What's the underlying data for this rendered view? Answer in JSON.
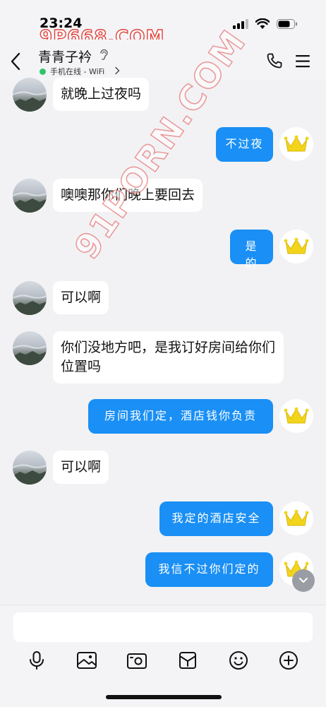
{
  "status_bar": {
    "time": "23:24",
    "watermark": "9P668.COM"
  },
  "header": {
    "contact_name": "青青子衿",
    "online_status": "手机在线 - WiFi"
  },
  "watermark_diag": "91PORN.COM",
  "messages": [
    {
      "side": "left",
      "text": "就晚上过夜吗"
    },
    {
      "side": "right",
      "text": "不过夜"
    },
    {
      "side": "left",
      "text": "噢噢那你们晚上要回去"
    },
    {
      "side": "right",
      "text": "是的"
    },
    {
      "side": "left",
      "text": "可以啊"
    },
    {
      "side": "left",
      "text": "你们没地方吧，是我订好房间给你们位置吗"
    },
    {
      "side": "right",
      "text": "房间我们定，酒店钱你负责"
    },
    {
      "side": "left",
      "text": "可以啊"
    },
    {
      "side": "right",
      "text": "我定的酒店安全"
    },
    {
      "side": "right",
      "text": "我信不过你们定的"
    }
  ],
  "colors": {
    "bubble_right": "#1a8ff5",
    "bubble_left": "#ffffff",
    "background": "#f2f2f4",
    "online": "#2fc56a"
  },
  "toolbar": [
    "microphone-icon",
    "image-icon",
    "camera-icon",
    "red-packet-icon",
    "emoji-icon",
    "plus-icon"
  ]
}
